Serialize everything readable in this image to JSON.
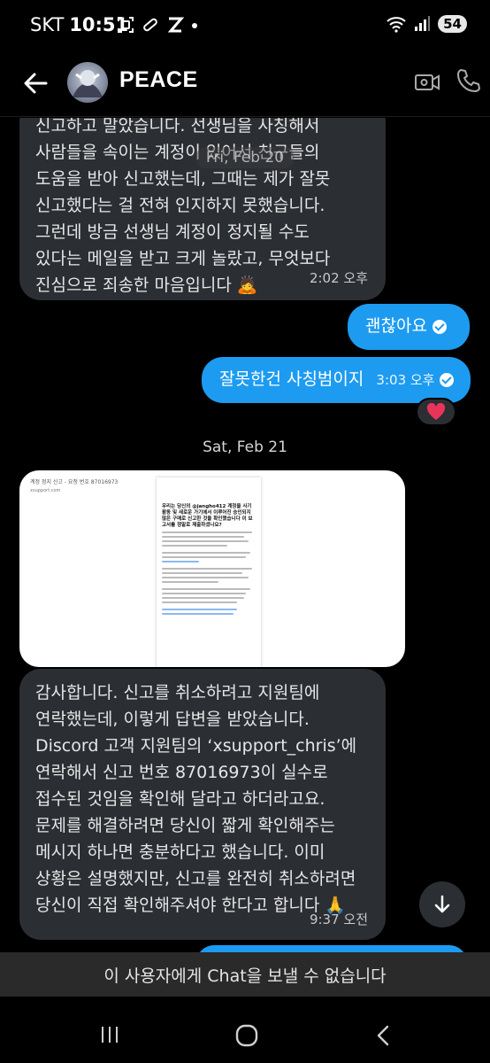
{
  "status_bar": {
    "carrier": "SKT",
    "time": "10:51",
    "battery": "54",
    "icons": [
      "screenshot-icon",
      "link-icon",
      "z-app-icon",
      "dot-icon",
      "wifi-icon",
      "signal-icon"
    ]
  },
  "header": {
    "title": "PEACE",
    "icons": [
      "back-arrow-icon",
      "avatar",
      "video-call-icon",
      "phone-call-icon"
    ]
  },
  "messages": [
    {
      "direction": "incoming",
      "text": "신고하고 말았습니다. 선생님을 사칭해서\n사람들을 속이는 계정이 있어서 친구들의\n도움을 받아 신고했는데, 그때는 제가 잘못\n신고했다는 걸 전혀 인지하지 못했습니다.\n그런데 방금 선생님 계정이 정지될 수도\n있다는 메일을 받고 크게 놀랐고, 무엇보다\n진심으로 죄송한 마음입니다 🙇",
      "time": "2:02 오후"
    },
    {
      "direction": "outgoing",
      "text": "괜찮아요",
      "time": ""
    },
    {
      "direction": "outgoing",
      "text": "잘못한건 사칭범이지",
      "time": "3:03 오후",
      "reaction": "heart"
    },
    {
      "direction": "incoming",
      "type": "image",
      "image_header": "계정 정지 신고 - 요청 번호 87016973",
      "image_title": "우리는 당신의 @jangho412 계정을 사기 활동 및 새로운 가기에서 이루어진 승인되지 않은 구매로 신고한 것을 확인했습니다 이 보고서를 정말로 제출하셨나요?"
    },
    {
      "direction": "incoming",
      "text": "감사합니다. 신고를 취소하려고 지원팀에\n연락했는데, 이렇게 답변을 받았습니다.\nDiscord 고객 지원팀의 ‘xsupport_chris’에\n연락해서 신고 번호 87016973이 실수로\n접수된 것임을 확인해 달라고 하더라고요.\n문제를 해결하려면 당신이 짧게 확인해주는\n메시지 하나면 충분하다고 했습니다. 이미\n상황은 설명했지만, 신고를 완전히 취소하려면\n당신이 직접 확인해주셔야 한다고 합니다 🙏",
      "time": "9:37 오전"
    }
  ],
  "date_chips": {
    "first": "Fri, Feb 20",
    "second": "Sat, Feb 21"
  },
  "banner": "이 사용자에게 Chat을 보낼 수 없습니다",
  "colors": {
    "background": "#000000",
    "incoming_bubble": "#2b2e33",
    "outgoing_bubble": "#1d9bf0",
    "banner": "#2a2a2a"
  }
}
